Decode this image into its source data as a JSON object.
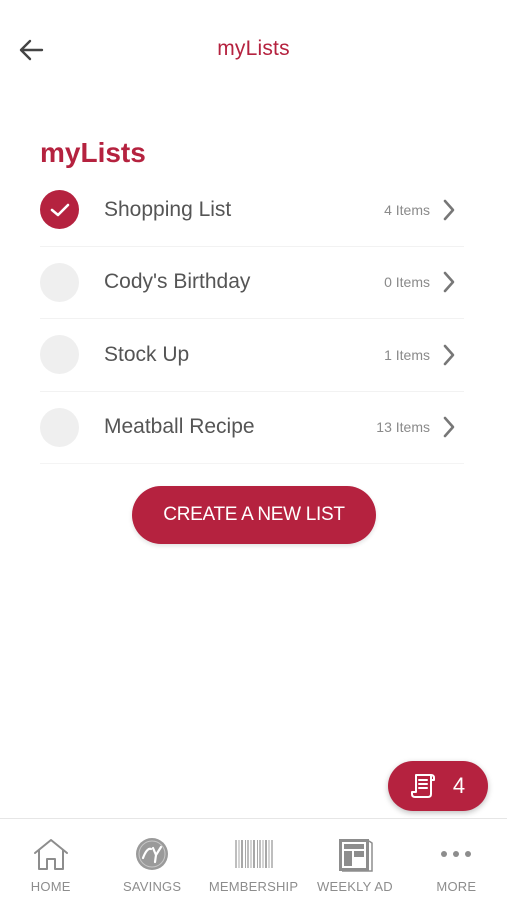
{
  "header": {
    "title": "myLists"
  },
  "section": {
    "title": "myLists"
  },
  "lists": [
    {
      "name": "Shopping List",
      "count": "4 Items",
      "selected": true
    },
    {
      "name": "Cody's Birthday",
      "count": "0 Items",
      "selected": false
    },
    {
      "name": "Stock Up",
      "count": "1 Items",
      "selected": false
    },
    {
      "name": "Meatball Recipe",
      "count": "13 Items",
      "selected": false
    }
  ],
  "create_button": {
    "label": "CREATE A NEW LIST"
  },
  "fab": {
    "count": "4",
    "icon": "receipt-icon"
  },
  "tabbar": [
    {
      "label": "HOME",
      "icon": "home-icon"
    },
    {
      "label": "SAVINGS",
      "icon": "big-y-logo-icon"
    },
    {
      "label": "MEMBERSHIP",
      "icon": "barcode-icon"
    },
    {
      "label": "WEEKLY AD",
      "icon": "weekly-ad-icon"
    },
    {
      "label": "MORE",
      "icon": "more-dots-icon"
    }
  ],
  "colors": {
    "accent": "#b5223f",
    "text": "#555555",
    "muted": "#8d8d8d"
  }
}
